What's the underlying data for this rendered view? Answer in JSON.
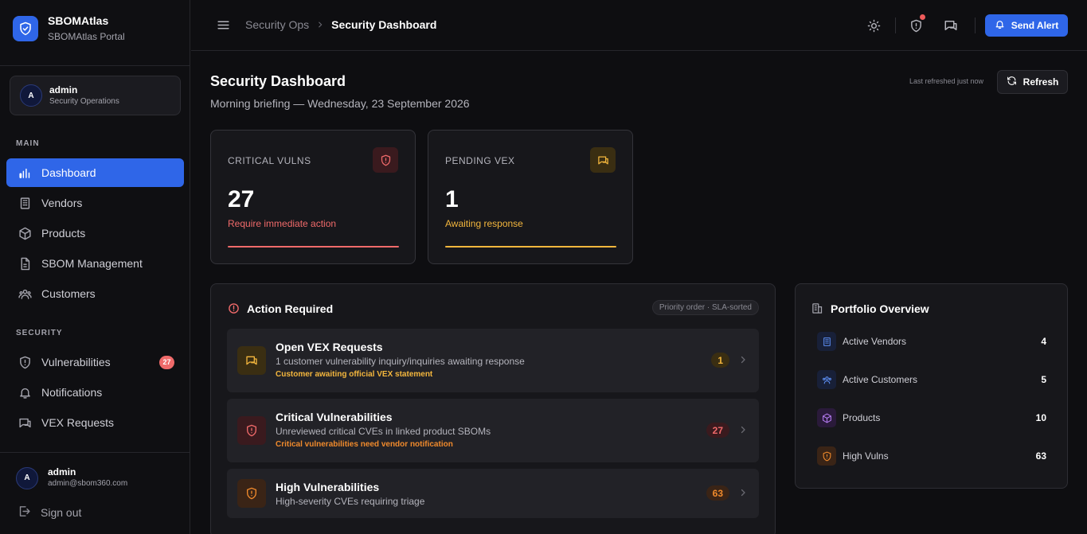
{
  "brand": {
    "name": "SBOMAtlas",
    "subtitle": "SBOMAtlas Portal"
  },
  "user_card": {
    "initial": "A",
    "name": "admin",
    "role": "Security Operations"
  },
  "sidebar": {
    "main_label": "MAIN",
    "main_items": [
      {
        "label": "Dashboard",
        "icon": "bar-chart-icon",
        "active": true
      },
      {
        "label": "Vendors",
        "icon": "building-icon"
      },
      {
        "label": "Products",
        "icon": "cube-icon"
      },
      {
        "label": "SBOM Management",
        "icon": "file-icon"
      },
      {
        "label": "Customers",
        "icon": "users-icon"
      }
    ],
    "security_label": "SECURITY",
    "security_items": [
      {
        "label": "Vulnerabilities",
        "icon": "shield-alert-icon",
        "badge": "27"
      },
      {
        "label": "Notifications",
        "icon": "bell-icon"
      },
      {
        "label": "VEX Requests",
        "icon": "chat-icon"
      }
    ]
  },
  "footer_user": {
    "initial": "A",
    "name": "admin",
    "email": "admin@sbom360.com"
  },
  "sign_out": "Sign out",
  "topbar": {
    "breadcrumb": [
      "Security Ops",
      "Security Dashboard"
    ],
    "send_alert": "Send Alert"
  },
  "page": {
    "title": "Security Dashboard",
    "subtitle": "Morning briefing — Wednesday, 23 September 2026",
    "last_refreshed": "Last refreshed just now",
    "refresh": "Refresh"
  },
  "stats": [
    {
      "label": "CRITICAL VULNS",
      "value": "27",
      "desc": "Require immediate action",
      "color": "#f06a6a"
    },
    {
      "label": "PENDING VEX",
      "value": "1",
      "desc": "Awaiting response",
      "color": "#f3b63d"
    }
  ],
  "action_required": {
    "title": "Action Required",
    "badge": "Priority order · SLA-sorted",
    "rows": [
      {
        "title": "Open VEX Requests",
        "desc": "1 customer vulnerability inquiry/inquiries awaiting response",
        "note": "Customer awaiting official VEX statement",
        "count": "1"
      },
      {
        "title": "Critical Vulnerabilities",
        "desc": "Unreviewed critical CVEs in linked product SBOMs",
        "note": "Critical vulnerabilities need vendor notification",
        "count": "27"
      },
      {
        "title": "High Vulnerabilities",
        "desc": "High-severity CVEs requiring triage",
        "count": "63"
      }
    ]
  },
  "portfolio": {
    "title": "Portfolio Overview",
    "rows": [
      {
        "label": "Active Vendors",
        "value": "4"
      },
      {
        "label": "Active Customers",
        "value": "5"
      },
      {
        "label": "Products",
        "value": "10"
      },
      {
        "label": "High Vulns",
        "value": "63"
      }
    ]
  }
}
